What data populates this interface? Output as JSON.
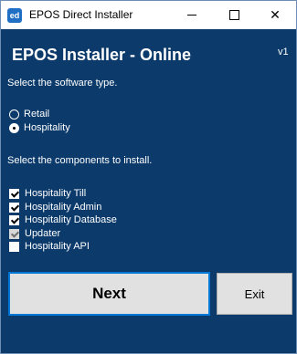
{
  "window": {
    "title": "EPOS Direct Installer",
    "icon_text": "ed",
    "minimize_icon": "minimize-icon",
    "maximize_icon": "maximize-icon",
    "close_icon": "close-icon",
    "close_glyph": "✕"
  },
  "header": {
    "title": "EPOS Installer - Online",
    "version": "v1"
  },
  "software_type": {
    "prompt": "Select the software type.",
    "options": [
      {
        "label": "Retail",
        "selected": false
      },
      {
        "label": "Hospitality",
        "selected": true
      }
    ]
  },
  "components": {
    "prompt": "Select the components to install.",
    "items": [
      {
        "label": "Hospitality Till",
        "checked": true,
        "enabled": true
      },
      {
        "label": "Hospitality Admin",
        "checked": true,
        "enabled": true
      },
      {
        "label": "Hospitality Database",
        "checked": true,
        "enabled": true
      },
      {
        "label": "Updater",
        "checked": true,
        "enabled": false
      },
      {
        "label": "Hospitality API",
        "checked": false,
        "enabled": true
      }
    ]
  },
  "buttons": {
    "next_label": "Next",
    "exit_label": "Exit"
  },
  "colors": {
    "background": "#0b3a6b",
    "accent": "#0078d7"
  }
}
